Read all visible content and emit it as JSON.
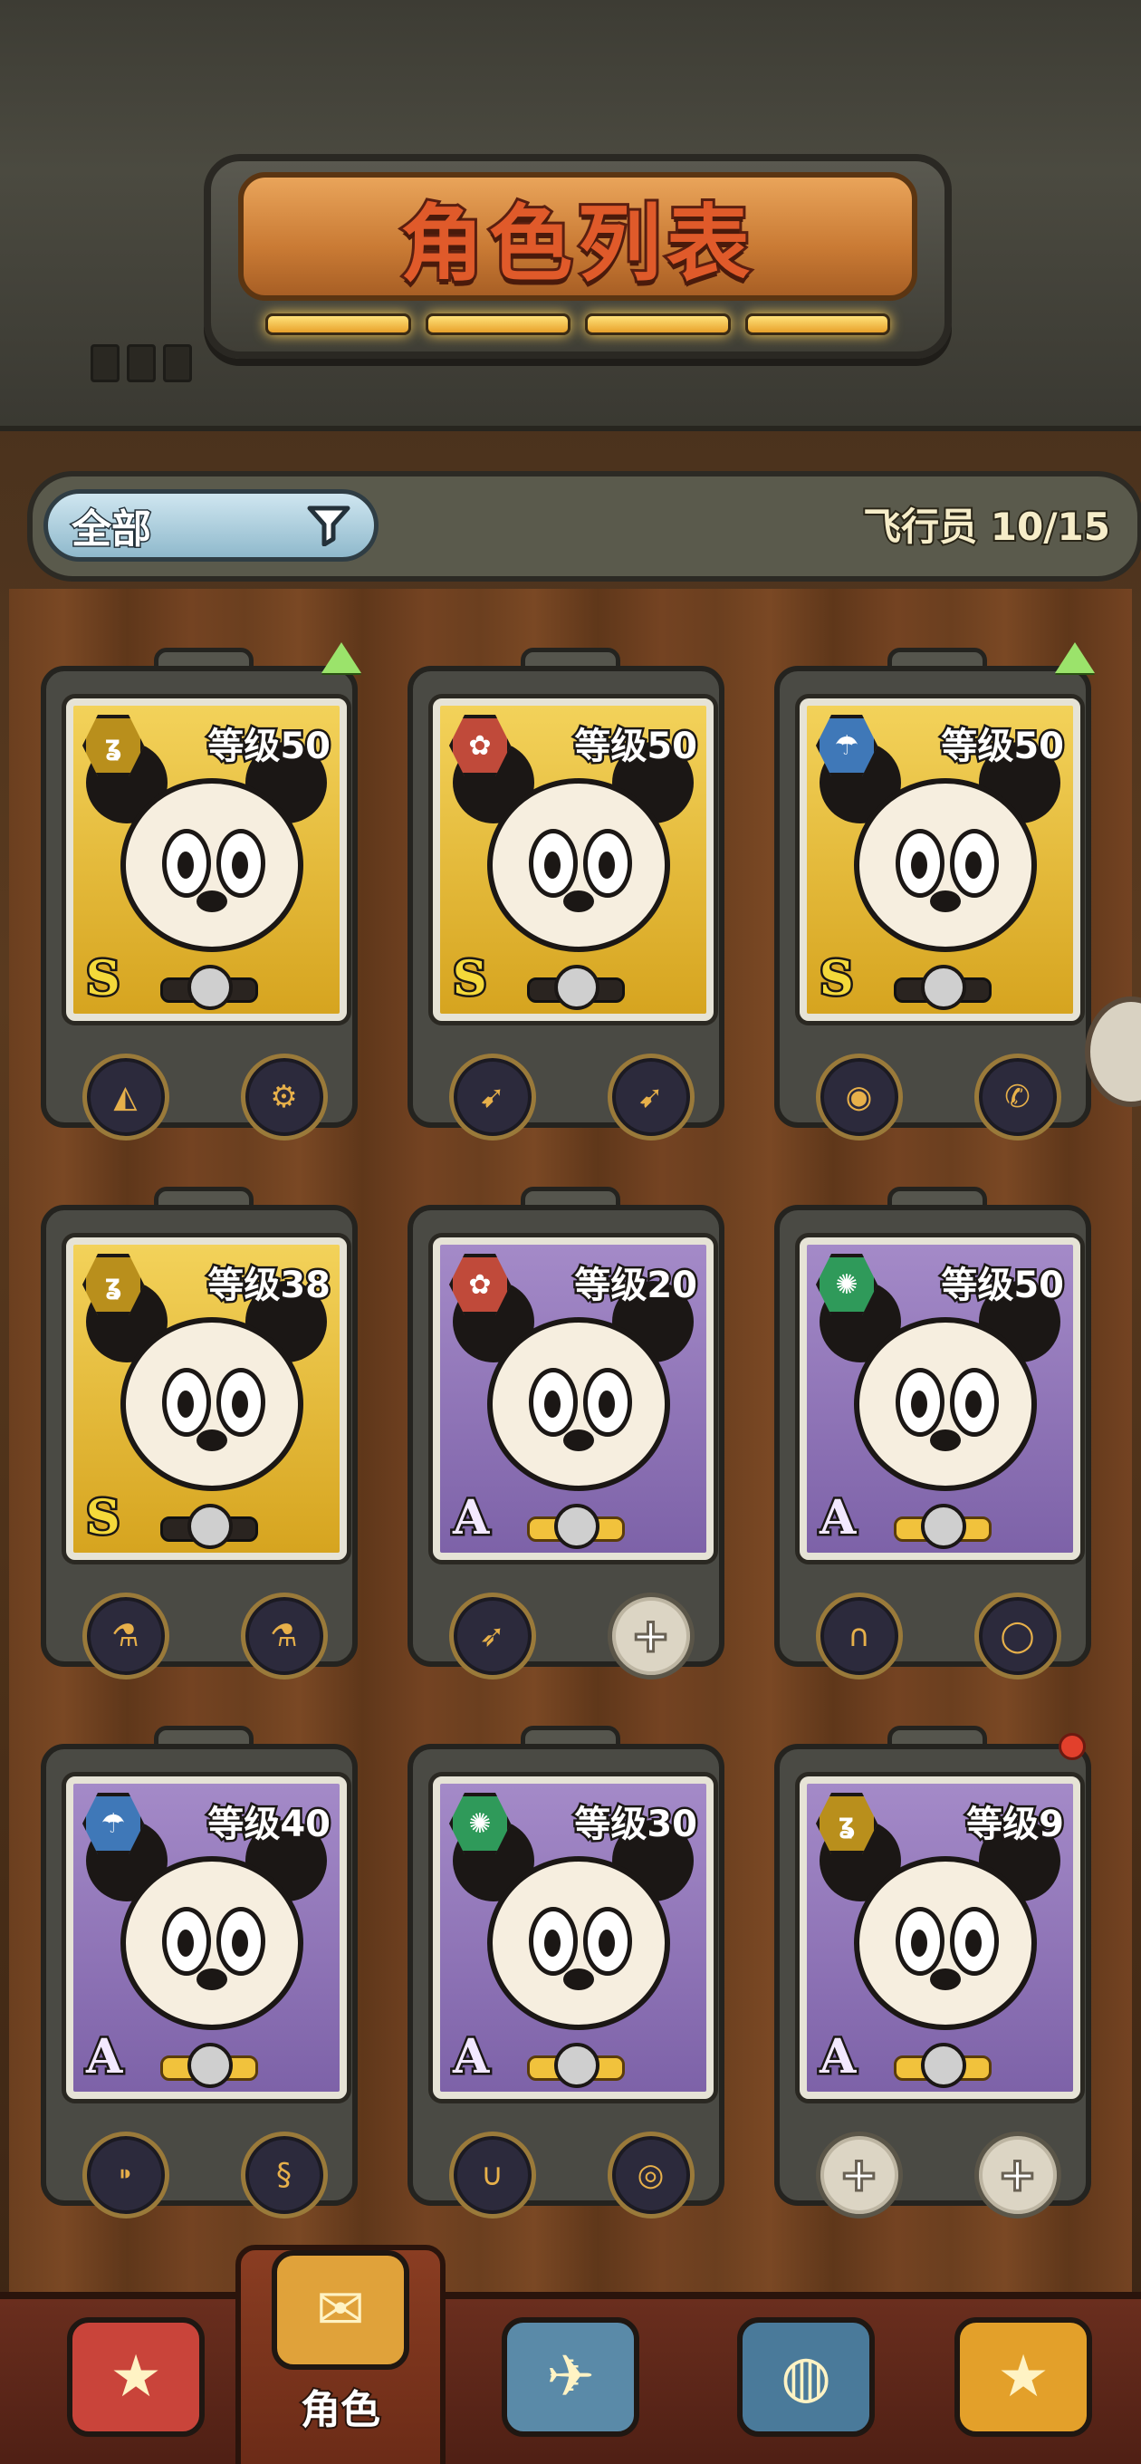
{
  "header": {
    "title": "角色列表"
  },
  "filter": {
    "selected": "全部",
    "pilot_label": "飞行员",
    "pilot_count": "10/15"
  },
  "colors": {
    "gold_bg": "#f3d25a",
    "purple_bg": "#a48ac8",
    "rank_S": "#f4d93a",
    "rank_A": "#f3e9ff",
    "upgrade": "#9be36b"
  },
  "cards": [
    {
      "level": "等级50",
      "rank": "S",
      "element": "wind-icon",
      "bg": "gold",
      "upgrade": true,
      "slots": [
        "drill-part-icon",
        "engine-part-icon"
      ]
    },
    {
      "level": "等级50",
      "rank": "S",
      "element": "flower-icon",
      "bg": "gold",
      "upgrade": false,
      "slots": [
        "rocket-part-icon",
        "rocket-part-icon"
      ]
    },
    {
      "level": "等级50",
      "rank": "S",
      "element": "rain-icon",
      "bg": "gold",
      "upgrade": true,
      "slots": [
        "eye-orb-part-icon",
        "horn-part-icon"
      ]
    },
    {
      "level": "等级38",
      "rank": "S",
      "element": "wind-icon",
      "bg": "gold",
      "upgrade": false,
      "slots": [
        "potion-part-icon",
        "potion-part-icon"
      ]
    },
    {
      "level": "等级20",
      "rank": "A",
      "element": "flower-icon",
      "bg": "purple",
      "upgrade": false,
      "slots": [
        "missile-part-icon",
        "add-slot"
      ]
    },
    {
      "level": "等级50",
      "rank": "A",
      "element": "swirl-icon",
      "bg": "purple",
      "upgrade": false,
      "slots": [
        "horseshoe-part-icon",
        "ring-part-icon"
      ]
    },
    {
      "level": "等级40",
      "rank": "A",
      "element": "rain-icon",
      "bg": "purple",
      "upgrade": false,
      "slots": [
        "cannon-part-icon",
        "spring-part-icon"
      ]
    },
    {
      "level": "等级30",
      "rank": "A",
      "element": "swirl-icon",
      "bg": "purple",
      "upgrade": false,
      "slots": [
        "magnet-part-icon",
        "tire-part-icon"
      ]
    },
    {
      "level": "等级9",
      "rank": "A",
      "element": "wind-icon",
      "bg": "purple",
      "upgrade": false,
      "notify": true,
      "slots": [
        "add-slot",
        "add-slot"
      ]
    }
  ],
  "nav": [
    {
      "name": "star-box-icon",
      "label": ""
    },
    {
      "name": "character-trunk-icon",
      "label": "角色",
      "active": true
    },
    {
      "name": "airship-icon",
      "label": ""
    },
    {
      "name": "pilot-helmet-icon",
      "label": ""
    },
    {
      "name": "star-book-icon",
      "label": ""
    }
  ]
}
